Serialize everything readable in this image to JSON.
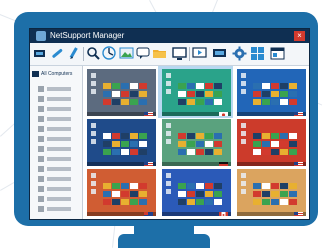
{
  "window": {
    "title": "NetSupport Manager",
    "close_glyph": "×"
  },
  "toolbar": {
    "icons": [
      "connect-icon",
      "chain-icon",
      "pen-icon",
      "search-icon",
      "chart-icon",
      "image-icon",
      "chat-icon",
      "folder-icon",
      "display-icon",
      "presentation-icon",
      "monitor-icon",
      "gear-icon",
      "grid-icon",
      "layout-icon"
    ]
  },
  "sidebar": {
    "all_computers_label": "All Computers"
  },
  "colors": {
    "frame": "#1d6fa8",
    "titlebar": "#0f2f52",
    "close": "#d23a2e",
    "selection": "#b8d8f0"
  },
  "thumbnails": [
    {
      "name": "slate-desktop",
      "bg": "#5c6b7f",
      "flag": "us"
    },
    {
      "name": "green-desktop",
      "bg": "#2aa38a",
      "flag": "jp",
      "selected": true
    },
    {
      "name": "blue-desktop",
      "bg": "#2266b8",
      "flag": "us"
    },
    {
      "name": "navy-desktop",
      "bg": "#1f4b8a",
      "flag": "us"
    },
    {
      "name": "mint-desktop",
      "bg": "#5aa27e",
      "flag": "de"
    },
    {
      "name": "red-desktop",
      "bg": "#cc3b2b",
      "flag": "us"
    },
    {
      "name": "orange-desktop",
      "bg": "#d05d33",
      "flag": "au"
    },
    {
      "name": "royal-desktop",
      "bg": "#2b5ab8",
      "flag": "ca"
    },
    {
      "name": "sand-desktop",
      "bg": "#dba45f",
      "flag": "us"
    }
  ]
}
